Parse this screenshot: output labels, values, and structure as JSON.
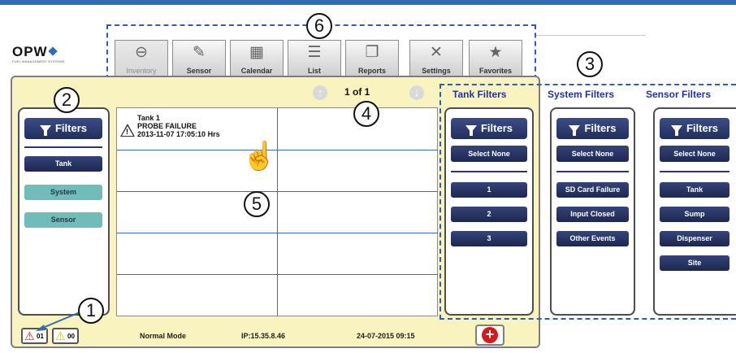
{
  "logo": {
    "main": "OPW",
    "sub": "FUEL MANAGEMENT SYSTEMS"
  },
  "tabs": [
    {
      "label": "Inventory",
      "icon": "tank-icon",
      "glyph": "⊖"
    },
    {
      "label": "Sensor",
      "icon": "probe-icon",
      "glyph": "✎"
    },
    {
      "label": "Calendar",
      "icon": "calendar-icon",
      "glyph": "▦"
    },
    {
      "label": "List",
      "icon": "list-icon",
      "glyph": "☰"
    },
    {
      "label": "Reports",
      "icon": "reports-icon",
      "glyph": "❐"
    },
    {
      "label": "Settings",
      "icon": "tools-icon",
      "glyph": "✕"
    },
    {
      "label": "Favorites",
      "icon": "star-icon",
      "glyph": "★"
    }
  ],
  "callouts": [
    "1",
    "2",
    "3",
    "4",
    "5",
    "6"
  ],
  "pager": {
    "text": "1 of 1",
    "up": "↑",
    "down": "↓"
  },
  "left_filters": {
    "button": "Filters",
    "items": [
      {
        "label": "Tank",
        "active": true
      },
      {
        "label": "System",
        "active": false
      },
      {
        "label": "Sensor",
        "active": false
      }
    ]
  },
  "tank_filters": {
    "title": "Tank Filters",
    "button": "Filters",
    "select_none": "Select None",
    "items": [
      "1",
      "2",
      "3"
    ]
  },
  "system_filters": {
    "title": "System Filters",
    "button": "Filters",
    "select_none": "Select None",
    "items": [
      "SD Card Failure",
      "Input Closed",
      "Other Events"
    ]
  },
  "sensor_filters": {
    "title": "Sensor Filters",
    "button": "Filters",
    "select_none": "Select None",
    "items": [
      "Tank",
      "Sump",
      "Dispenser",
      "Site"
    ]
  },
  "alarm": {
    "tank": "Tank 1",
    "status": "PROBE FAILURE",
    "time": "2013-11-07 17:05:10 Hrs"
  },
  "status_bar": {
    "alarm_count": "01",
    "warning_count": "00",
    "mode": "Normal Mode",
    "ip": "IP:15.35.8.46",
    "datetime": "24-07-2015 09:15",
    "add": "+"
  },
  "colors": {
    "accent": "#2f59c7",
    "panel": "#f8f3bf",
    "button": "#222f5c",
    "inactive_filter": "#6fbcb9",
    "add": "#d21b1b"
  }
}
